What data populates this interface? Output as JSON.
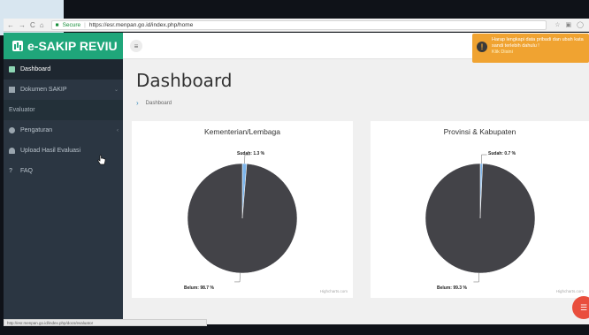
{
  "browser": {
    "secure_label": "Secure",
    "url": "https://esr.menpan.go.id/index.php/home"
  },
  "app": {
    "brand": "e-SAKIP REVIU"
  },
  "toast": {
    "message": "Harap lengkapi data pribadi dan ubah kata sandi terlebih dahulu !",
    "link": "Klik Disini"
  },
  "sidebar": {
    "items": [
      {
        "label": "Dashboard"
      },
      {
        "label": "Dokumen SAKIP"
      },
      {
        "label": "Evaluator"
      },
      {
        "label": "Pengaturan"
      },
      {
        "label": "Upload Hasil Evaluasi"
      },
      {
        "label": "FAQ"
      }
    ]
  },
  "page": {
    "title": "Dashboard",
    "breadcrumb": "Dashboard"
  },
  "status_url": "http://esr.menpan.go.id/index.php/docs/evaluator",
  "colors": {
    "brand": "#1fa67a",
    "sidebar": "#2b3642",
    "toast": "#f0a331",
    "pie_done": "#7cb5ec",
    "pie_not_done": "#434348",
    "fab": "#e94e3d"
  },
  "chart_data": [
    {
      "type": "pie",
      "title": "Kementerian/Lembaga",
      "slices": [
        {
          "label": "Sudah: 1.3 %",
          "value": 1.3
        },
        {
          "label": "Belum: 98.7 %",
          "value": 98.7
        }
      ],
      "credit": "Highcharts.com"
    },
    {
      "type": "pie",
      "title": "Provinsi & Kabupaten",
      "slices": [
        {
          "label": "Sudah: 0.7 %",
          "value": 0.7
        },
        {
          "label": "Belum: 99.3 %",
          "value": 99.3
        }
      ],
      "credit": "Highcharts.com"
    }
  ]
}
